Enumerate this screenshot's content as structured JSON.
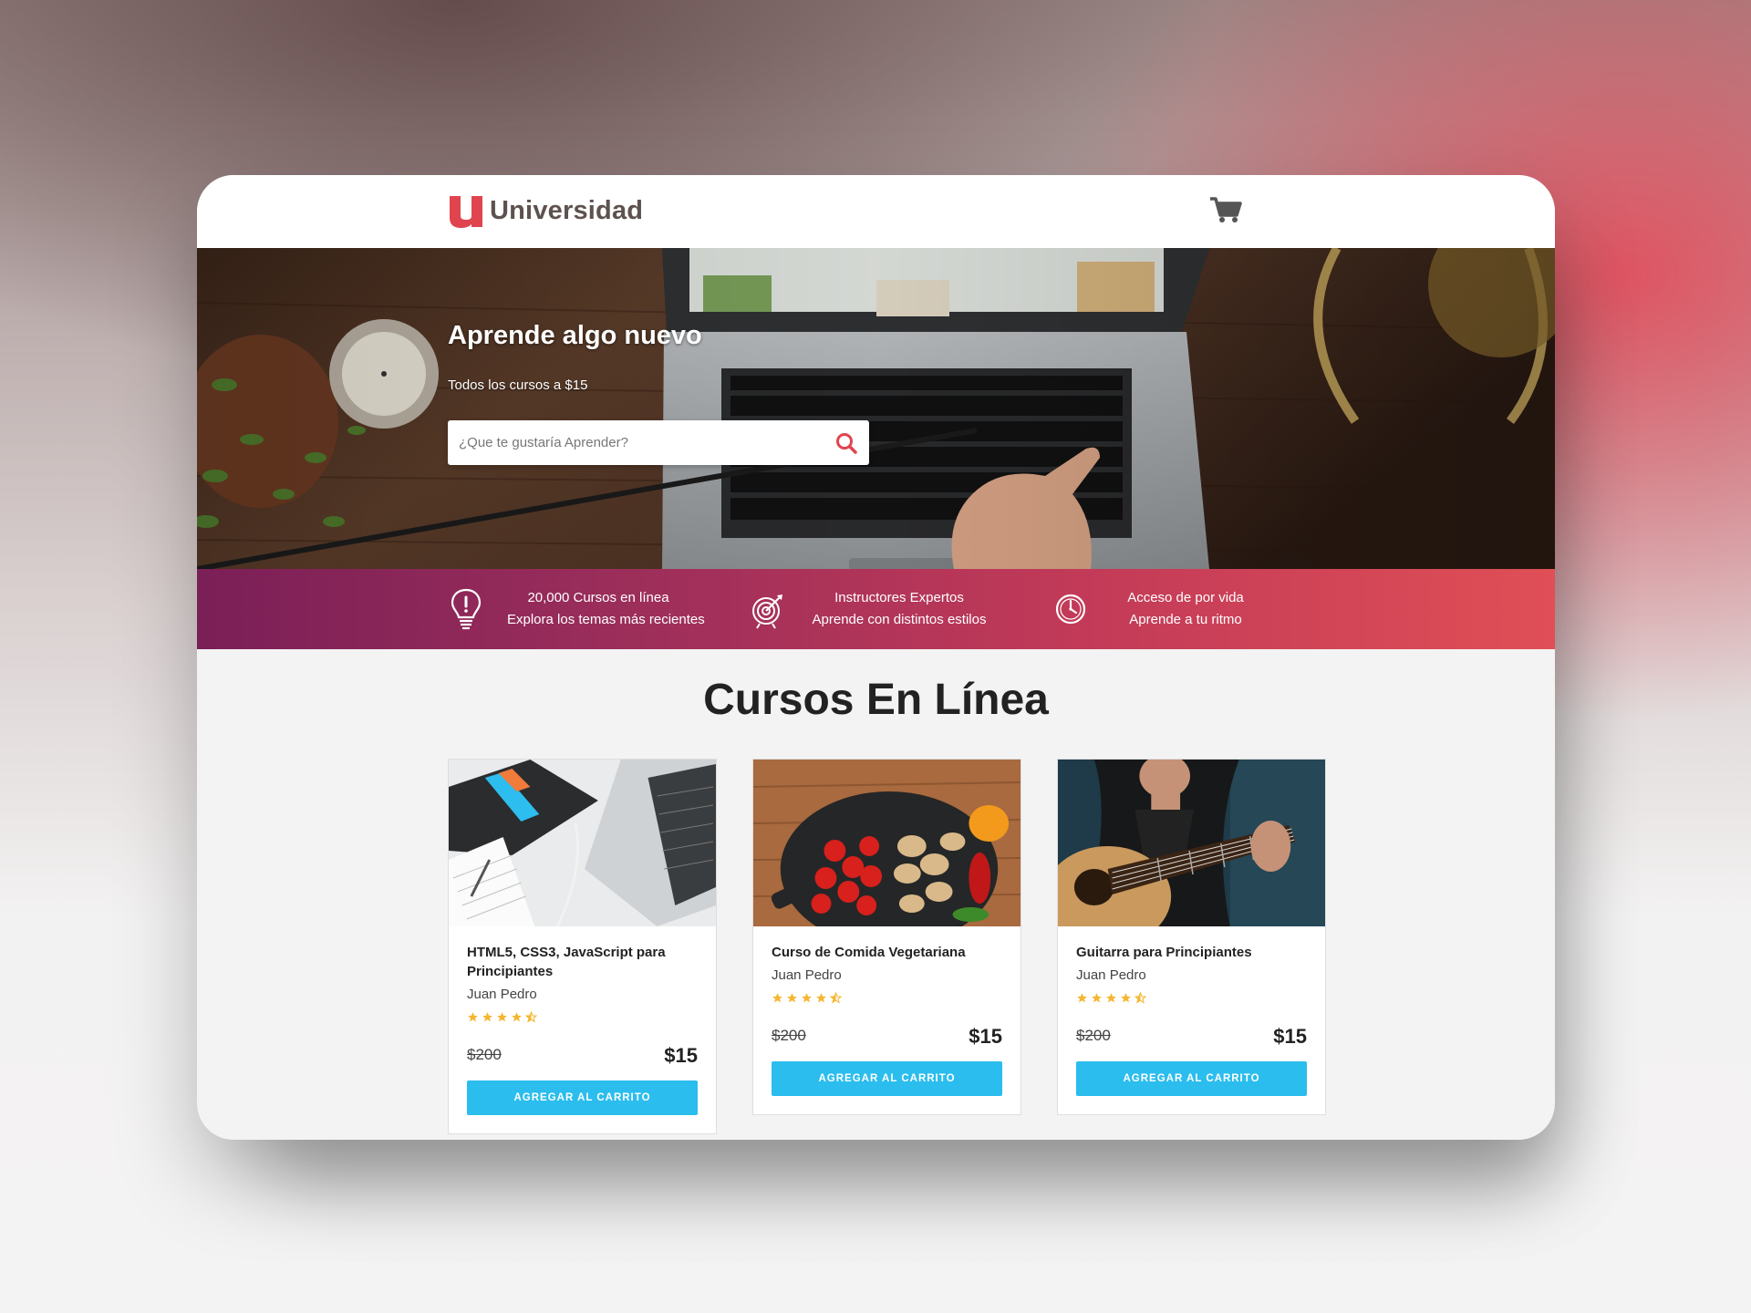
{
  "brand": {
    "name": "Universidad",
    "accent": "#e0454f",
    "text_color": "#5e524e"
  },
  "header": {
    "cart_icon": "cart-icon"
  },
  "hero": {
    "title": "Aprende algo nuevo",
    "subtitle": "Todos los cursos a $15",
    "search_placeholder": "¿Que te gustaría Aprender?",
    "search_icon": "search-icon"
  },
  "features": [
    {
      "icon": "lightbulb-icon",
      "line1": "20,000 Cursos en línea",
      "line2": "Explora los temas más recientes"
    },
    {
      "icon": "target-icon",
      "line1": "Instructores Expertos",
      "line2": "Aprende con distintos estilos"
    },
    {
      "icon": "clock-icon",
      "line1": "Acceso de por vida",
      "line2": "Aprende a tu ritmo"
    }
  ],
  "courses_section": {
    "title": "Cursos En Línea"
  },
  "courses": [
    {
      "title": "HTML5, CSS3, JavaScript para Principiantes",
      "author": "Juan Pedro",
      "rating": 4.5,
      "old_price": "$200",
      "price": "$15",
      "button": "AGREGAR AL CARRITO"
    },
    {
      "title": "Curso de Comida Vegetariana",
      "author": "Juan Pedro",
      "rating": 4.5,
      "old_price": "$200",
      "price": "$15",
      "button": "AGREGAR AL CARRITO"
    },
    {
      "title": "Guitarra para Principiantes",
      "author": "Juan Pedro",
      "rating": 4.5,
      "old_price": "$200",
      "price": "$15",
      "button": "AGREGAR AL CARRITO"
    }
  ],
  "colors": {
    "button": "#2bbdee",
    "star": "#f5b731",
    "features_start": "#7a1f57",
    "features_end": "#e04f56"
  }
}
